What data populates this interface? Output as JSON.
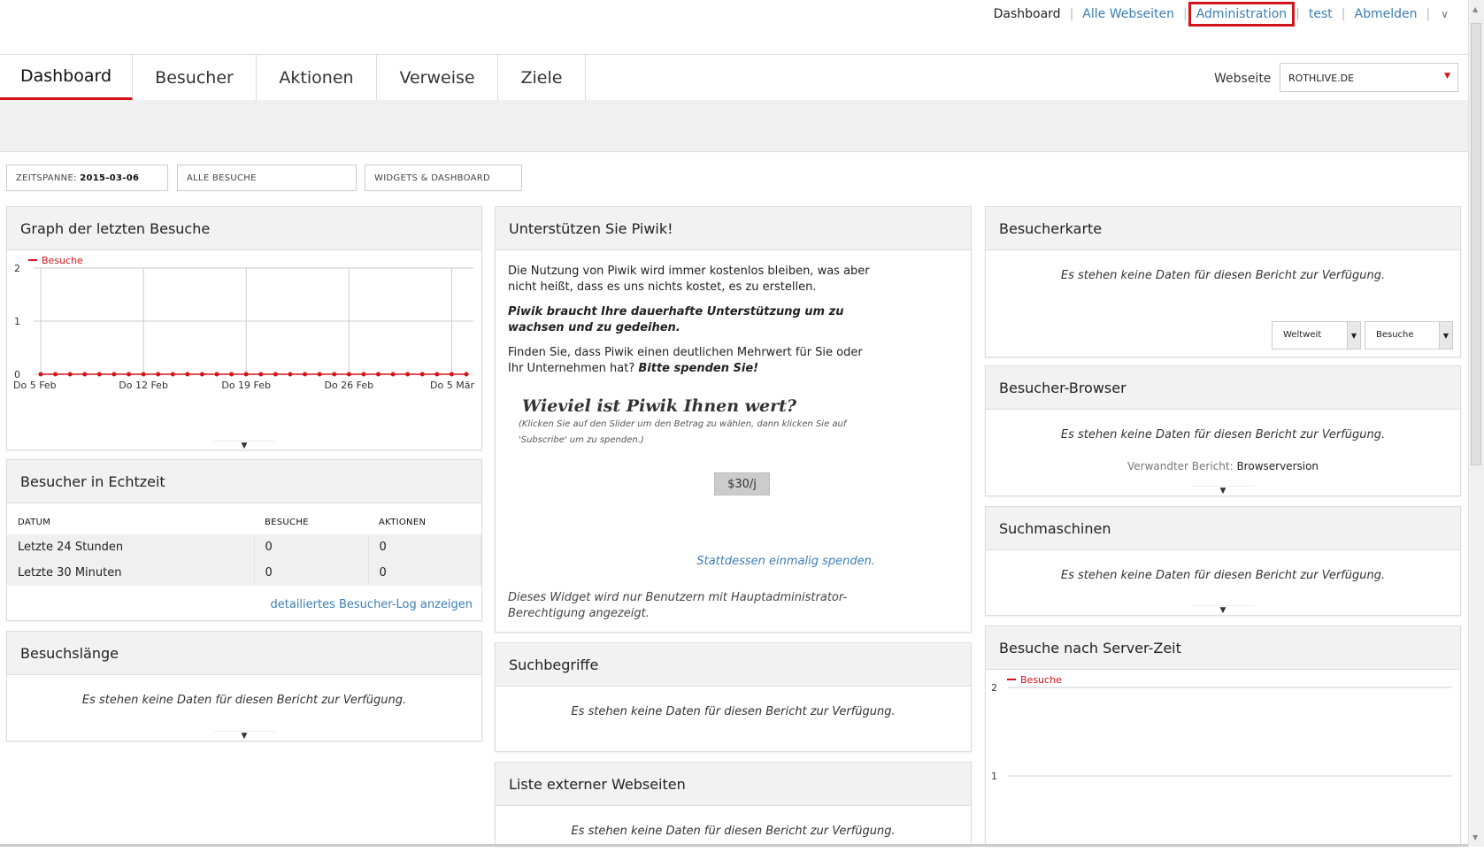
{
  "topnav": {
    "dashboard": "Dashboard",
    "all_sites": "Alle Webseiten",
    "administration": "Administration",
    "user": "test",
    "logout": "Abmelden",
    "sep": "|",
    "more_icon": "chevron-down-icon"
  },
  "tabs": [
    "Dashboard",
    "Besucher",
    "Aktionen",
    "Verweise",
    "Ziele"
  ],
  "site_selector": {
    "label": "Webseite",
    "value": "ROTHLIVE.DE"
  },
  "filters": {
    "period_label": "ZEITSPANNE:",
    "period_value": "2015-03-06",
    "segment": "ALLE BESUCHE",
    "widgets": "WIDGETS & DASHBOARD"
  },
  "nodata_text": "Es stehen keine Daten für diesen Bericht zur Verfügung.",
  "widgets": {
    "visits_graph": {
      "title": "Graph der letzten Besuche",
      "legend": "Besuche",
      "y_ticks": [
        "2",
        "1",
        "0"
      ],
      "x_ticks": [
        "Do 5 Feb",
        "Do 12 Feb",
        "Do 19 Feb",
        "Do 26 Feb",
        "Do 5 Mär"
      ]
    },
    "realtime": {
      "title": "Besucher in Echtzeit",
      "headers": [
        "DATUM",
        "BESUCHE",
        "AKTIONEN"
      ],
      "rows": [
        [
          "Letzte 24 Stunden",
          "0",
          "0"
        ],
        [
          "Letzte 30 Minuten",
          "0",
          "0"
        ]
      ],
      "log_link": "detailiertes Besucher-Log anzeigen"
    },
    "visit_length": {
      "title": "Besuchslänge"
    },
    "support": {
      "title": "Unterstützen Sie Piwik!",
      "p1": "Die Nutzung von Piwik wird immer kostenlos bleiben, was aber nicht heißt, dass es uns nichts kostet, es zu erstellen.",
      "p2": "Piwik braucht Ihre dauerhafte Unterstützung um zu wachsen und zu gedeihen.",
      "p3a": "Finden Sie, dass Piwik einen deutlichen Mehrwert für Sie oder Ihr Unternehmen hat?",
      "p3b": "Bitte spenden Sie!",
      "worth": "Wieviel ist Piwik Ihnen wert?",
      "hint": "(Klicken Sie auf den Slider um den Betrag zu wählen, dann klicken Sie auf 'Subscribe' um zu spenden.)",
      "amount": "$30/j",
      "once_link": "Stattdessen einmalig spenden.",
      "admin_note": "Dieses Widget wird nur Benutzern mit Hauptadministrator-Berechtigung angezeigt."
    },
    "keywords": {
      "title": "Suchbegriffe"
    },
    "outlinks": {
      "title": "Liste externer Webseiten"
    },
    "map": {
      "title": "Besucherkarte",
      "scope": "Weltweit",
      "metric": "Besuche"
    },
    "browsers": {
      "title": "Besucher-Browser",
      "related_label": "Verwandter Bericht:",
      "related_value": "Browserversion"
    },
    "search_engines": {
      "title": "Suchmaschinen"
    },
    "server_time": {
      "title": "Besuche nach Server-Zeit",
      "legend": "Besuche",
      "y_ticks": [
        "2",
        "1"
      ]
    }
  },
  "chart_data": [
    {
      "type": "line",
      "title": "Graph der letzten Besuche",
      "x": [
        "Do 5 Feb",
        "Do 12 Feb",
        "Do 19 Feb",
        "Do 26 Feb",
        "Do 5 Mär"
      ],
      "series": [
        {
          "name": "Besuche",
          "values": [
            0,
            0,
            0,
            0,
            0,
            0,
            0,
            0,
            0,
            0,
            0,
            0,
            0,
            0,
            0,
            0,
            0,
            0,
            0,
            0,
            0,
            0,
            0,
            0,
            0,
            0,
            0,
            0,
            0,
            0
          ]
        }
      ],
      "ylim": [
        0,
        2
      ],
      "color": "#d3141c"
    },
    {
      "type": "bar",
      "title": "Besuche nach Server-Zeit",
      "series": [
        {
          "name": "Besuche",
          "values": []
        }
      ],
      "ylim": [
        0,
        2
      ]
    }
  ]
}
